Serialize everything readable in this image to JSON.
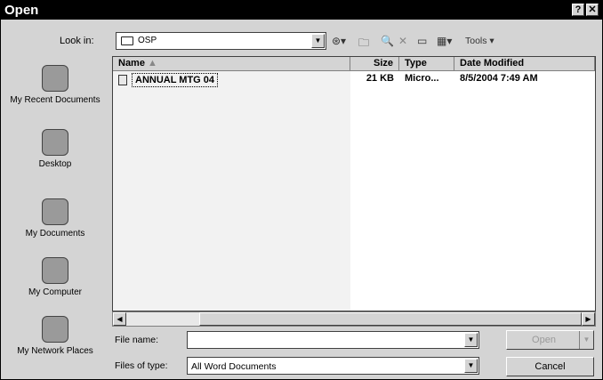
{
  "dialog": {
    "title": "Open",
    "help_label": "?",
    "close_label": "✕"
  },
  "lookin": {
    "label": "Look in:",
    "value": "OSP"
  },
  "toolbar": {
    "tools_label": "Tools"
  },
  "places": [
    {
      "label": "My Recent Documents"
    },
    {
      "label": "Desktop"
    },
    {
      "label": "My Documents"
    },
    {
      "label": "My Computer"
    },
    {
      "label": "My Network Places"
    }
  ],
  "columns": {
    "name": "Name",
    "size": "Size",
    "type": "Type",
    "date": "Date Modified"
  },
  "files": [
    {
      "name": "ANNUAL MTG 04",
      "size": "21 KB",
      "type": "Micro...",
      "date": "8/5/2004 7:49 AM"
    }
  ],
  "filename": {
    "label": "File name:",
    "value": ""
  },
  "filetype": {
    "label": "Files of type:",
    "value": "All Word Documents"
  },
  "buttons": {
    "open": "Open",
    "cancel": "Cancel"
  }
}
